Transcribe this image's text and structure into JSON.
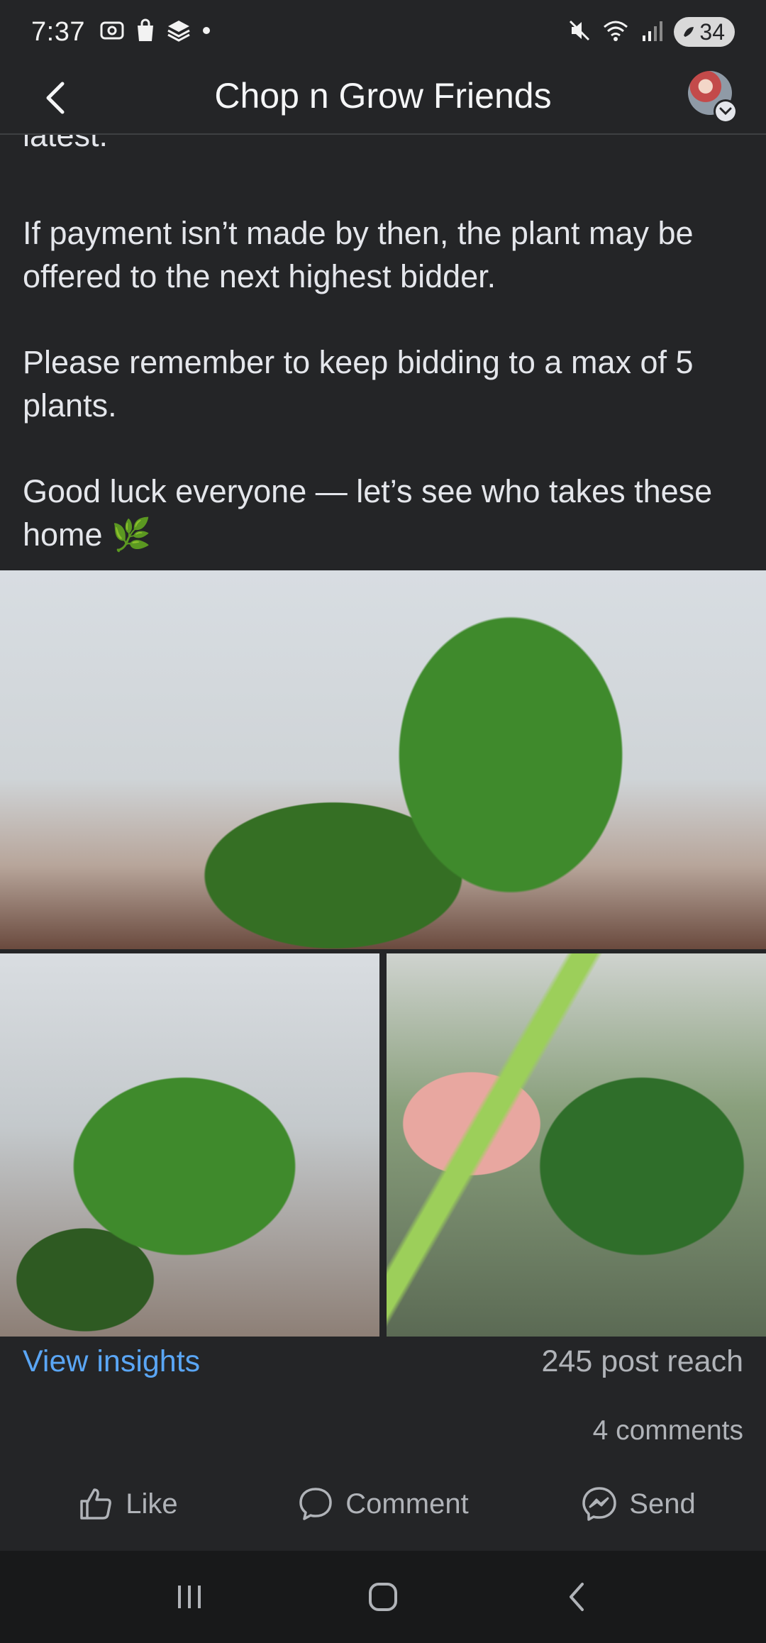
{
  "status_bar": {
    "time": "7:37",
    "battery": "34",
    "left_icons": [
      "screenshot-icon",
      "shop-icon",
      "layers-icon",
      "dot-icon"
    ],
    "right_icons": [
      "mute-icon",
      "wifi-icon",
      "signal-icon",
      "battery-icon"
    ]
  },
  "header": {
    "title": "Chop n Grow Friends",
    "back_icon": "chevron-left-icon",
    "avatar_badge_icon": "chevron-down-icon"
  },
  "post": {
    "partial_line": "latest.",
    "paragraphs": [
      "If payment isn’t made by then, the plant may be offered to the next highest bidder.",
      "Please remember to keep bidding to a max of 5 plants.",
      "Good luck everyone — let’s see who takes these home 🌿"
    ],
    "images": [
      "monstera-leaf-photo",
      "monstera-leaf-closeup-photo",
      "monstera-cutting-in-hand-photo"
    ]
  },
  "stats": {
    "insights_label": "View insights",
    "reach": "245 post reach",
    "comments": "4 comments"
  },
  "actions": {
    "like": "Like",
    "comment": "Comment",
    "send": "Send"
  },
  "nav": {
    "recents_icon": "recents-icon",
    "home_icon": "home-icon",
    "back_icon": "back-icon"
  },
  "colors": {
    "background": "#242527",
    "link": "#5aa6f5",
    "muted": "#b0b3b8",
    "text": "#e4e6eb",
    "nav_bg": "#18191a"
  }
}
